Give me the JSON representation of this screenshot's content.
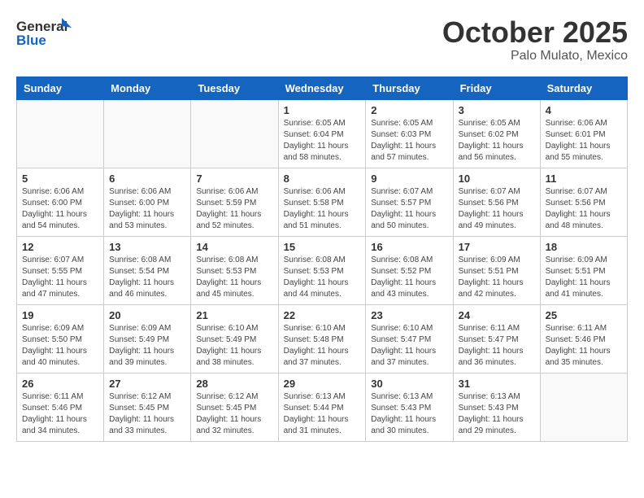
{
  "header": {
    "logo_line1": "General",
    "logo_line2": "Blue",
    "month": "October 2025",
    "location": "Palo Mulato, Mexico"
  },
  "weekdays": [
    "Sunday",
    "Monday",
    "Tuesday",
    "Wednesday",
    "Thursday",
    "Friday",
    "Saturday"
  ],
  "weeks": [
    [
      {
        "day": "",
        "info": ""
      },
      {
        "day": "",
        "info": ""
      },
      {
        "day": "",
        "info": ""
      },
      {
        "day": "1",
        "info": "Sunrise: 6:05 AM\nSunset: 6:04 PM\nDaylight: 11 hours\nand 58 minutes."
      },
      {
        "day": "2",
        "info": "Sunrise: 6:05 AM\nSunset: 6:03 PM\nDaylight: 11 hours\nand 57 minutes."
      },
      {
        "day": "3",
        "info": "Sunrise: 6:05 AM\nSunset: 6:02 PM\nDaylight: 11 hours\nand 56 minutes."
      },
      {
        "day": "4",
        "info": "Sunrise: 6:06 AM\nSunset: 6:01 PM\nDaylight: 11 hours\nand 55 minutes."
      }
    ],
    [
      {
        "day": "5",
        "info": "Sunrise: 6:06 AM\nSunset: 6:00 PM\nDaylight: 11 hours\nand 54 minutes."
      },
      {
        "day": "6",
        "info": "Sunrise: 6:06 AM\nSunset: 6:00 PM\nDaylight: 11 hours\nand 53 minutes."
      },
      {
        "day": "7",
        "info": "Sunrise: 6:06 AM\nSunset: 5:59 PM\nDaylight: 11 hours\nand 52 minutes."
      },
      {
        "day": "8",
        "info": "Sunrise: 6:06 AM\nSunset: 5:58 PM\nDaylight: 11 hours\nand 51 minutes."
      },
      {
        "day": "9",
        "info": "Sunrise: 6:07 AM\nSunset: 5:57 PM\nDaylight: 11 hours\nand 50 minutes."
      },
      {
        "day": "10",
        "info": "Sunrise: 6:07 AM\nSunset: 5:56 PM\nDaylight: 11 hours\nand 49 minutes."
      },
      {
        "day": "11",
        "info": "Sunrise: 6:07 AM\nSunset: 5:56 PM\nDaylight: 11 hours\nand 48 minutes."
      }
    ],
    [
      {
        "day": "12",
        "info": "Sunrise: 6:07 AM\nSunset: 5:55 PM\nDaylight: 11 hours\nand 47 minutes."
      },
      {
        "day": "13",
        "info": "Sunrise: 6:08 AM\nSunset: 5:54 PM\nDaylight: 11 hours\nand 46 minutes."
      },
      {
        "day": "14",
        "info": "Sunrise: 6:08 AM\nSunset: 5:53 PM\nDaylight: 11 hours\nand 45 minutes."
      },
      {
        "day": "15",
        "info": "Sunrise: 6:08 AM\nSunset: 5:53 PM\nDaylight: 11 hours\nand 44 minutes."
      },
      {
        "day": "16",
        "info": "Sunrise: 6:08 AM\nSunset: 5:52 PM\nDaylight: 11 hours\nand 43 minutes."
      },
      {
        "day": "17",
        "info": "Sunrise: 6:09 AM\nSunset: 5:51 PM\nDaylight: 11 hours\nand 42 minutes."
      },
      {
        "day": "18",
        "info": "Sunrise: 6:09 AM\nSunset: 5:51 PM\nDaylight: 11 hours\nand 41 minutes."
      }
    ],
    [
      {
        "day": "19",
        "info": "Sunrise: 6:09 AM\nSunset: 5:50 PM\nDaylight: 11 hours\nand 40 minutes."
      },
      {
        "day": "20",
        "info": "Sunrise: 6:09 AM\nSunset: 5:49 PM\nDaylight: 11 hours\nand 39 minutes."
      },
      {
        "day": "21",
        "info": "Sunrise: 6:10 AM\nSunset: 5:49 PM\nDaylight: 11 hours\nand 38 minutes."
      },
      {
        "day": "22",
        "info": "Sunrise: 6:10 AM\nSunset: 5:48 PM\nDaylight: 11 hours\nand 37 minutes."
      },
      {
        "day": "23",
        "info": "Sunrise: 6:10 AM\nSunset: 5:47 PM\nDaylight: 11 hours\nand 37 minutes."
      },
      {
        "day": "24",
        "info": "Sunrise: 6:11 AM\nSunset: 5:47 PM\nDaylight: 11 hours\nand 36 minutes."
      },
      {
        "day": "25",
        "info": "Sunrise: 6:11 AM\nSunset: 5:46 PM\nDaylight: 11 hours\nand 35 minutes."
      }
    ],
    [
      {
        "day": "26",
        "info": "Sunrise: 6:11 AM\nSunset: 5:46 PM\nDaylight: 11 hours\nand 34 minutes."
      },
      {
        "day": "27",
        "info": "Sunrise: 6:12 AM\nSunset: 5:45 PM\nDaylight: 11 hours\nand 33 minutes."
      },
      {
        "day": "28",
        "info": "Sunrise: 6:12 AM\nSunset: 5:45 PM\nDaylight: 11 hours\nand 32 minutes."
      },
      {
        "day": "29",
        "info": "Sunrise: 6:13 AM\nSunset: 5:44 PM\nDaylight: 11 hours\nand 31 minutes."
      },
      {
        "day": "30",
        "info": "Sunrise: 6:13 AM\nSunset: 5:43 PM\nDaylight: 11 hours\nand 30 minutes."
      },
      {
        "day": "31",
        "info": "Sunrise: 6:13 AM\nSunset: 5:43 PM\nDaylight: 11 hours\nand 29 minutes."
      },
      {
        "day": "",
        "info": ""
      }
    ]
  ]
}
